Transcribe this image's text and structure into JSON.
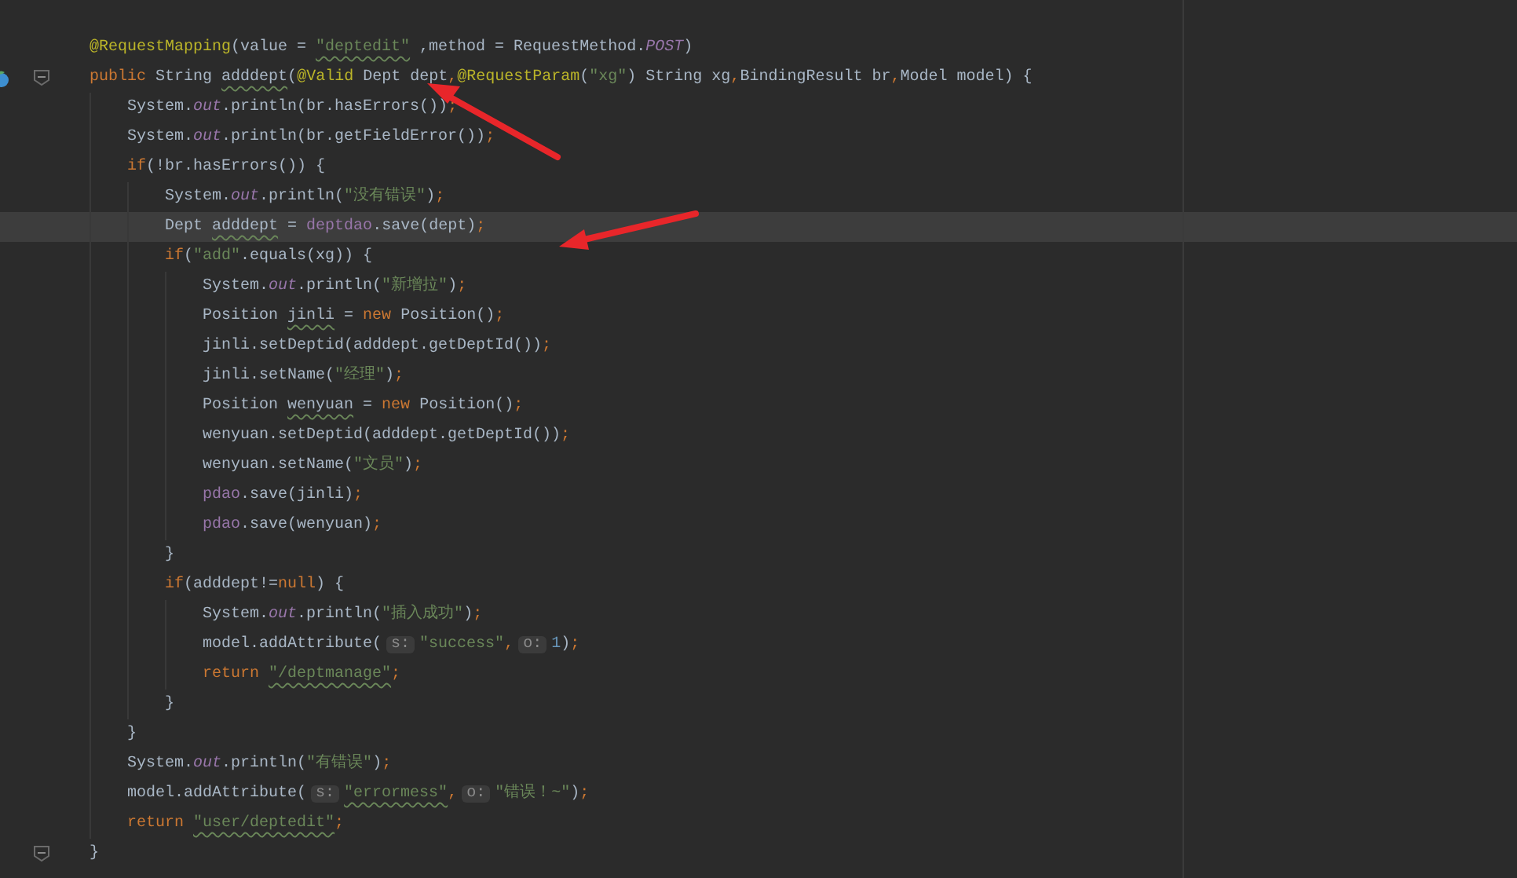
{
  "editor": {
    "lines": [
      {
        "current": false,
        "tokens": [
          {
            "kind": "annot",
            "text": "@RequestMapping"
          },
          {
            "kind": "plain",
            "text": "(value = "
          },
          {
            "kind": "str",
            "text": "\"deptedit\"",
            "squiggle": true
          },
          {
            "kind": "plain",
            "text": " ,method = RequestMethod."
          },
          {
            "kind": "static",
            "text": "POST"
          },
          {
            "kind": "plain",
            "text": ")"
          }
        ]
      },
      {
        "current": false,
        "fold": true,
        "gutter_icon": true,
        "tokens": [
          {
            "kind": "kw",
            "text": "public"
          },
          {
            "kind": "plain",
            "text": " String "
          },
          {
            "kind": "plain",
            "text": "adddept",
            "squiggle": true
          },
          {
            "kind": "plain",
            "text": "("
          },
          {
            "kind": "annot",
            "text": "@Valid"
          },
          {
            "kind": "plain",
            "text": " Dept dept"
          },
          {
            "kind": "punct",
            "text": ","
          },
          {
            "kind": "annot",
            "text": "@RequestParam"
          },
          {
            "kind": "plain",
            "text": "("
          },
          {
            "kind": "str",
            "text": "\"xg\""
          },
          {
            "kind": "plain",
            "text": ") String xg"
          },
          {
            "kind": "punct",
            "text": ","
          },
          {
            "kind": "plain",
            "text": "BindingResult br"
          },
          {
            "kind": "punct",
            "text": ","
          },
          {
            "kind": "plain",
            "text": "Model model) {"
          }
        ],
        "children": [
          {
            "current": false,
            "tokens": [
              {
                "kind": "plain",
                "text": "System."
              },
              {
                "kind": "static",
                "text": "out"
              },
              {
                "kind": "plain",
                "text": ".println(br.hasErrors())"
              },
              {
                "kind": "punct",
                "text": ";"
              }
            ]
          },
          {
            "current": false,
            "tokens": [
              {
                "kind": "plain",
                "text": "System."
              },
              {
                "kind": "static",
                "text": "out"
              },
              {
                "kind": "plain",
                "text": ".println(br.getFieldError())"
              },
              {
                "kind": "punct",
                "text": ";"
              }
            ]
          },
          {
            "current": false,
            "tokens": [
              {
                "kind": "kw",
                "text": "if"
              },
              {
                "kind": "plain",
                "text": "(!br.hasErrors()) {"
              }
            ],
            "children": [
              {
                "current": false,
                "tokens": [
                  {
                    "kind": "plain",
                    "text": "System."
                  },
                  {
                    "kind": "static",
                    "text": "out"
                  },
                  {
                    "kind": "plain",
                    "text": ".println("
                  },
                  {
                    "kind": "str",
                    "text": "\"没有错误\""
                  },
                  {
                    "kind": "plain",
                    "text": ")"
                  },
                  {
                    "kind": "punct",
                    "text": ";"
                  }
                ]
              },
              {
                "current": true,
                "tokens": [
                  {
                    "kind": "plain",
                    "text": "Dept "
                  },
                  {
                    "kind": "plain",
                    "text": "adddept",
                    "squiggle": true
                  },
                  {
                    "kind": "plain",
                    "text": " = "
                  },
                  {
                    "kind": "member",
                    "text": "deptdao"
                  },
                  {
                    "kind": "plain",
                    "text": ".save(dept)"
                  },
                  {
                    "kind": "punct",
                    "text": ";"
                  }
                ]
              },
              {
                "current": false,
                "tokens": [
                  {
                    "kind": "kw",
                    "text": "if"
                  },
                  {
                    "kind": "plain",
                    "text": "("
                  },
                  {
                    "kind": "str",
                    "text": "\"add\""
                  },
                  {
                    "kind": "plain",
                    "text": ".equals(xg)) {"
                  }
                ],
                "children": [
                  {
                    "current": false,
                    "tokens": [
                      {
                        "kind": "plain",
                        "text": "System."
                      },
                      {
                        "kind": "static",
                        "text": "out"
                      },
                      {
                        "kind": "plain",
                        "text": ".println("
                      },
                      {
                        "kind": "str",
                        "text": "\"新增拉\""
                      },
                      {
                        "kind": "plain",
                        "text": ")"
                      },
                      {
                        "kind": "punct",
                        "text": ";"
                      }
                    ]
                  },
                  {
                    "current": false,
                    "tokens": [
                      {
                        "kind": "plain",
                        "text": "Position "
                      },
                      {
                        "kind": "plain",
                        "text": "jinli",
                        "squiggle": true
                      },
                      {
                        "kind": "plain",
                        "text": " = "
                      },
                      {
                        "kind": "kw",
                        "text": "new"
                      },
                      {
                        "kind": "plain",
                        "text": " Position()"
                      },
                      {
                        "kind": "punct",
                        "text": ";"
                      }
                    ]
                  },
                  {
                    "current": false,
                    "tokens": [
                      {
                        "kind": "plain",
                        "text": "jinli.setDeptid(adddept.getDeptId())"
                      },
                      {
                        "kind": "punct",
                        "text": ";"
                      }
                    ]
                  },
                  {
                    "current": false,
                    "tokens": [
                      {
                        "kind": "plain",
                        "text": "jinli.setName("
                      },
                      {
                        "kind": "str",
                        "text": "\"经理\""
                      },
                      {
                        "kind": "plain",
                        "text": ")"
                      },
                      {
                        "kind": "punct",
                        "text": ";"
                      }
                    ]
                  },
                  {
                    "current": false,
                    "tokens": [
                      {
                        "kind": "plain",
                        "text": "Position "
                      },
                      {
                        "kind": "plain",
                        "text": "wenyuan",
                        "squiggle": true
                      },
                      {
                        "kind": "plain",
                        "text": " = "
                      },
                      {
                        "kind": "kw",
                        "text": "new"
                      },
                      {
                        "kind": "plain",
                        "text": " Position()"
                      },
                      {
                        "kind": "punct",
                        "text": ";"
                      }
                    ]
                  },
                  {
                    "current": false,
                    "tokens": [
                      {
                        "kind": "plain",
                        "text": "wenyuan.setDeptid(adddept.getDeptId())"
                      },
                      {
                        "kind": "punct",
                        "text": ";"
                      }
                    ]
                  },
                  {
                    "current": false,
                    "tokens": [
                      {
                        "kind": "plain",
                        "text": "wenyuan.setName("
                      },
                      {
                        "kind": "str",
                        "text": "\"文员\""
                      },
                      {
                        "kind": "plain",
                        "text": ")"
                      },
                      {
                        "kind": "punct",
                        "text": ";"
                      }
                    ]
                  },
                  {
                    "current": false,
                    "tokens": [
                      {
                        "kind": "member",
                        "text": "pdao"
                      },
                      {
                        "kind": "plain",
                        "text": ".save(jinli)"
                      },
                      {
                        "kind": "punct",
                        "text": ";"
                      }
                    ]
                  },
                  {
                    "current": false,
                    "tokens": [
                      {
                        "kind": "member",
                        "text": "pdao"
                      },
                      {
                        "kind": "plain",
                        "text": ".save(wenyuan)"
                      },
                      {
                        "kind": "punct",
                        "text": ";"
                      }
                    ]
                  }
                ]
              },
              {
                "current": false,
                "tokens": [
                  {
                    "kind": "plain",
                    "text": "}"
                  }
                ]
              },
              {
                "current": false,
                "tokens": [
                  {
                    "kind": "kw",
                    "text": "if"
                  },
                  {
                    "kind": "plain",
                    "text": "(adddept!="
                  },
                  {
                    "kind": "kw",
                    "text": "null"
                  },
                  {
                    "kind": "plain",
                    "text": ") {"
                  }
                ],
                "children": [
                  {
                    "current": false,
                    "tokens": [
                      {
                        "kind": "plain",
                        "text": "System."
                      },
                      {
                        "kind": "static",
                        "text": "out"
                      },
                      {
                        "kind": "plain",
                        "text": ".println("
                      },
                      {
                        "kind": "str",
                        "text": "\"插入成功\""
                      },
                      {
                        "kind": "plain",
                        "text": ")"
                      },
                      {
                        "kind": "punct",
                        "text": ";"
                      }
                    ]
                  },
                  {
                    "current": false,
                    "tokens": [
                      {
                        "kind": "plain",
                        "text": "model.addAttribute("
                      },
                      {
                        "kind": "hint",
                        "text": "s:"
                      },
                      {
                        "kind": "str",
                        "text": "\"success\""
                      },
                      {
                        "kind": "punct",
                        "text": ","
                      },
                      {
                        "kind": "hint",
                        "text": "o:"
                      },
                      {
                        "kind": "num",
                        "text": "1"
                      },
                      {
                        "kind": "plain",
                        "text": ")"
                      },
                      {
                        "kind": "punct",
                        "text": ";"
                      }
                    ]
                  },
                  {
                    "current": false,
                    "tokens": [
                      {
                        "kind": "kw",
                        "text": "return "
                      },
                      {
                        "kind": "str",
                        "text": "\"/deptmanage\"",
                        "squiggle": true
                      },
                      {
                        "kind": "punct",
                        "text": ";"
                      }
                    ]
                  }
                ]
              },
              {
                "current": false,
                "tokens": [
                  {
                    "kind": "plain",
                    "text": "}"
                  }
                ]
              }
            ]
          },
          {
            "current": false,
            "tokens": [
              {
                "kind": "plain",
                "text": "}"
              }
            ]
          },
          {
            "current": false,
            "tokens": [
              {
                "kind": "plain",
                "text": "System."
              },
              {
                "kind": "static",
                "text": "out"
              },
              {
                "kind": "plain",
                "text": ".println("
              },
              {
                "kind": "str",
                "text": "\"有错误\""
              },
              {
                "kind": "plain",
                "text": ")"
              },
              {
                "kind": "punct",
                "text": ";"
              }
            ]
          },
          {
            "current": false,
            "tokens": [
              {
                "kind": "plain",
                "text": "model.addAttribute("
              },
              {
                "kind": "hint",
                "text": "s:"
              },
              {
                "kind": "str",
                "text": "\"errormess\"",
                "squiggle": true
              },
              {
                "kind": "punct",
                "text": ","
              },
              {
                "kind": "hint",
                "text": "o:"
              },
              {
                "kind": "str",
                "text": "\"错误！~\""
              },
              {
                "kind": "plain",
                "text": ")"
              },
              {
                "kind": "punct",
                "text": ";"
              }
            ]
          },
          {
            "current": false,
            "tokens": [
              {
                "kind": "kw",
                "text": "return "
              },
              {
                "kind": "str",
                "text": "\"user/deptedit\"",
                "squiggle": true
              },
              {
                "kind": "punct",
                "text": ";"
              }
            ]
          }
        ]
      },
      {
        "current": false,
        "fold": true,
        "tokens": [
          {
            "kind": "plain",
            "text": "}"
          }
        ]
      }
    ]
  }
}
